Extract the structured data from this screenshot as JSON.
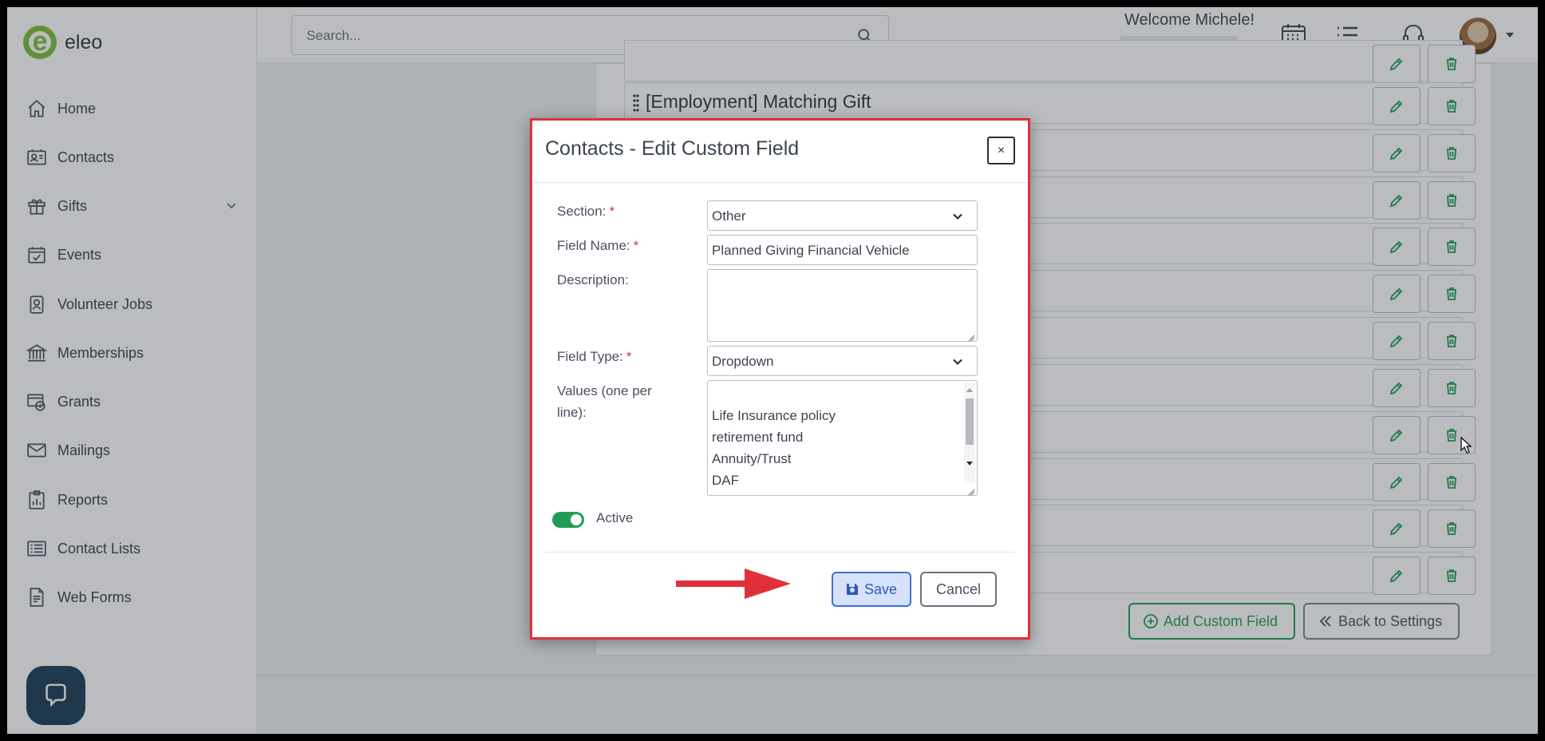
{
  "app": {
    "logo_text": "eleo"
  },
  "sidebar": {
    "items": [
      {
        "label": "Home",
        "icon": "home-icon"
      },
      {
        "label": "Contacts",
        "icon": "contact-card-icon"
      },
      {
        "label": "Gifts",
        "icon": "gift-icon",
        "has_submenu": true
      },
      {
        "label": "Events",
        "icon": "calendar-check-icon"
      },
      {
        "label": "Volunteer Jobs",
        "icon": "badge-icon"
      },
      {
        "label": "Memberships",
        "icon": "bank-icon"
      },
      {
        "label": "Grants",
        "icon": "grant-icon"
      },
      {
        "label": "Mailings",
        "icon": "envelope-icon"
      },
      {
        "label": "Reports",
        "icon": "clipboard-chart-icon"
      },
      {
        "label": "Contact Lists",
        "icon": "list-icon"
      },
      {
        "label": "Web Forms",
        "icon": "form-icon"
      }
    ]
  },
  "header": {
    "search_placeholder": "Search...",
    "welcome": "Welcome Michele!"
  },
  "background": {
    "visible_row_label": "[Employment] Matching Gift",
    "add_custom_field": "Add Custom Field",
    "back_to_settings": "Back to Settings"
  },
  "modal": {
    "title": "Contacts - Edit Custom Field",
    "close": "×",
    "section_label": "Section:",
    "section_value": "Other",
    "field_name_label": "Field Name:",
    "field_name_value": "Planned Giving Financial Vehicle",
    "description_label": "Description:",
    "description_value": "",
    "field_type_label": "Field Type:",
    "field_type_value": "Dropdown",
    "values_label": "Values (one per line):",
    "values": [
      "Life Insurance policy",
      "retirement fund",
      "Annuity/Trust",
      "DAF"
    ],
    "required_marker": "*",
    "active_label": "Active",
    "active": true,
    "save_label": "Save",
    "cancel_label": "Cancel"
  },
  "colors": {
    "brand_green": "#7bbf3a",
    "accent_green": "#1f9d55",
    "highlight_red": "#e0313a",
    "primary_blue": "#3d6fd6"
  }
}
